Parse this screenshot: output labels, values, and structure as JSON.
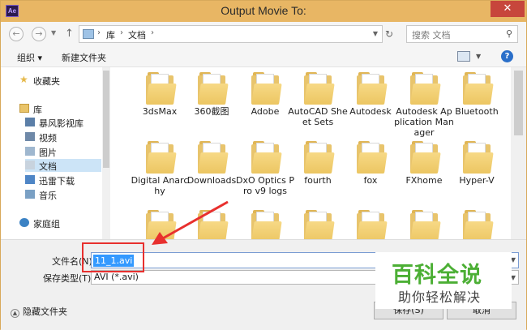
{
  "window": {
    "title": "Output Movie To:",
    "app_icon_text": "Ae",
    "close_symbol": "✕"
  },
  "nav": {
    "breadcrumb": [
      "库",
      "文档"
    ],
    "search_placeholder": "搜索 文档"
  },
  "toolbar": {
    "organize": "组织 ▾",
    "new_folder": "新建文件夹"
  },
  "sidebar": {
    "items": [
      {
        "label": "收藏夹",
        "icon": "star-icon"
      },
      {
        "label": "库",
        "icon": "library-icon"
      },
      {
        "label": "暴风影视库",
        "icon": "video-library-icon"
      },
      {
        "label": "视频",
        "icon": "video-icon"
      },
      {
        "label": "图片",
        "icon": "picture-icon"
      },
      {
        "label": "文档",
        "icon": "document-icon"
      },
      {
        "label": "迅雷下载",
        "icon": "download-icon"
      },
      {
        "label": "音乐",
        "icon": "music-icon"
      },
      {
        "label": "家庭组",
        "icon": "homegroup-icon"
      }
    ]
  },
  "folders": [
    "3dsMax",
    "360截图",
    "Adobe",
    "AutoCAD Sheet Sets",
    "Autodesk",
    "Autodesk Application Manager",
    "Bluetooth",
    "Digital Anarchy",
    "Downloads",
    "DxO Optics Pro v9 logs",
    "fourth",
    "fox",
    "FXhome",
    "Hyper-V"
  ],
  "file": {
    "name_label": "文件名(N):",
    "name_value": "11_1.avi",
    "type_label": "保存类型(T):",
    "type_value": "AVI (*.avi)"
  },
  "footer": {
    "hide_folders": "隐藏文件夹",
    "save": "保存(S)",
    "cancel": "取消"
  },
  "watermark": {
    "title": "百科全说",
    "subtitle": "助你轻松解决"
  },
  "colors": {
    "title_bar": "#e8b664",
    "selection": "#3399ff",
    "highlight_box": "#e8302e",
    "watermark_green": "#4caf35"
  }
}
